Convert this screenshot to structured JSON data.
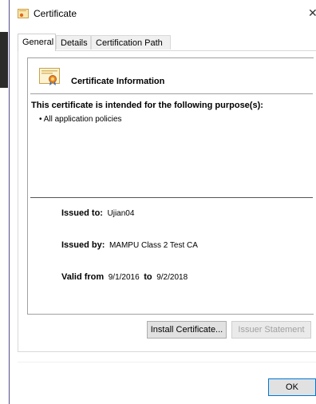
{
  "window": {
    "title": "Certificate",
    "close_glyph": "✕"
  },
  "tabs": [
    {
      "label": "General",
      "active": true
    },
    {
      "label": "Details",
      "active": false
    },
    {
      "label": "Certification Path",
      "active": false
    }
  ],
  "info": {
    "heading": "Certificate Information",
    "purpose_heading": "This certificate is intended for the following purpose(s):",
    "purposes": [
      "• All application policies"
    ],
    "issued_to_label": "Issued to:",
    "issued_to_value": "Ujian04",
    "issued_by_label": "Issued by:",
    "issued_by_value": "MAMPU Class 2 Test CA",
    "valid_from_label": "Valid from",
    "valid_from_value": "9/1/2016",
    "valid_to_label": "to",
    "valid_to_value": "9/2/2018"
  },
  "buttons": {
    "install": "Install Certificate...",
    "issuer": "Issuer Statement",
    "ok": "OK"
  },
  "icons": {
    "title": "certificate-icon",
    "info": "certificate-icon",
    "close": "close-icon"
  }
}
